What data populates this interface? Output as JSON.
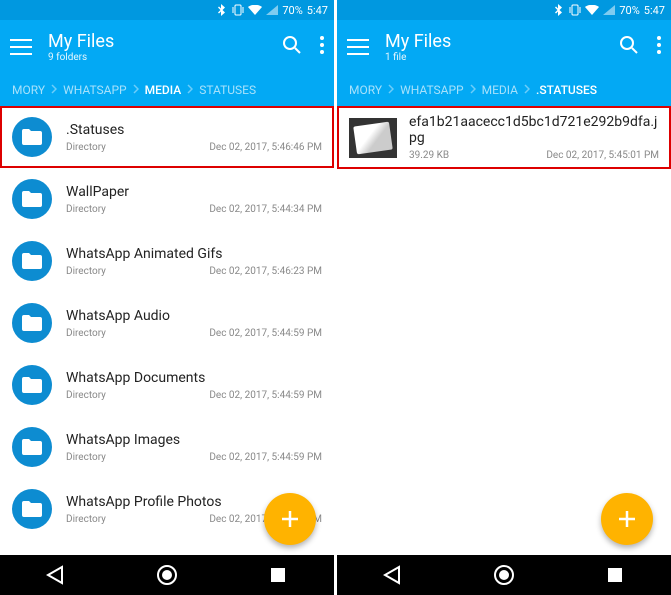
{
  "left": {
    "status": {
      "battery_pct": "70%",
      "time": "5:47"
    },
    "appbar": {
      "title": "My Files",
      "subtitle": "9 folders"
    },
    "breadcrumbs": [
      {
        "label": "MORY",
        "active": false
      },
      {
        "label": "WHATSAPP",
        "active": false
      },
      {
        "label": "MEDIA",
        "active": true
      },
      {
        "label": "STATUSES",
        "active": false
      }
    ],
    "rows": [
      {
        "title": ".Statuses",
        "type": "Directory",
        "date": "Dec 02, 2017, 5:46:46 PM",
        "highlight": true
      },
      {
        "title": "WallPaper",
        "type": "Directory",
        "date": "Dec 02, 2017, 5:44:34 PM"
      },
      {
        "title": "WhatsApp Animated Gifs",
        "type": "Directory",
        "date": "Dec 02, 2017, 5:46:23 PM"
      },
      {
        "title": "WhatsApp Audio",
        "type": "Directory",
        "date": "Dec 02, 2017, 5:44:59 PM"
      },
      {
        "title": "WhatsApp Documents",
        "type": "Directory",
        "date": "Dec 02, 2017, 5:44:59 PM"
      },
      {
        "title": "WhatsApp Images",
        "type": "Directory",
        "date": "Dec 02, 2017, 5:44:59 PM"
      },
      {
        "title": "WhatsApp Profile Photos",
        "type": "Directory",
        "date": "Dec 02, 2017, 5:44:59 PM"
      }
    ]
  },
  "right": {
    "status": {
      "battery_pct": "70%",
      "time": "5:47"
    },
    "appbar": {
      "title": "My Files",
      "subtitle": "1 file"
    },
    "breadcrumbs": [
      {
        "label": "MORY",
        "active": false
      },
      {
        "label": "WHATSAPP",
        "active": false
      },
      {
        "label": "MEDIA",
        "active": false
      },
      {
        "label": ".STATUSES",
        "active": true
      }
    ],
    "rows": [
      {
        "title": "efa1b21aacecc1d5bc1d721e292b9dfa.jpg",
        "size": "39.29 KB",
        "date": "Dec 02, 2017, 5:45:01 PM",
        "highlight": true,
        "thumb": true
      }
    ]
  }
}
